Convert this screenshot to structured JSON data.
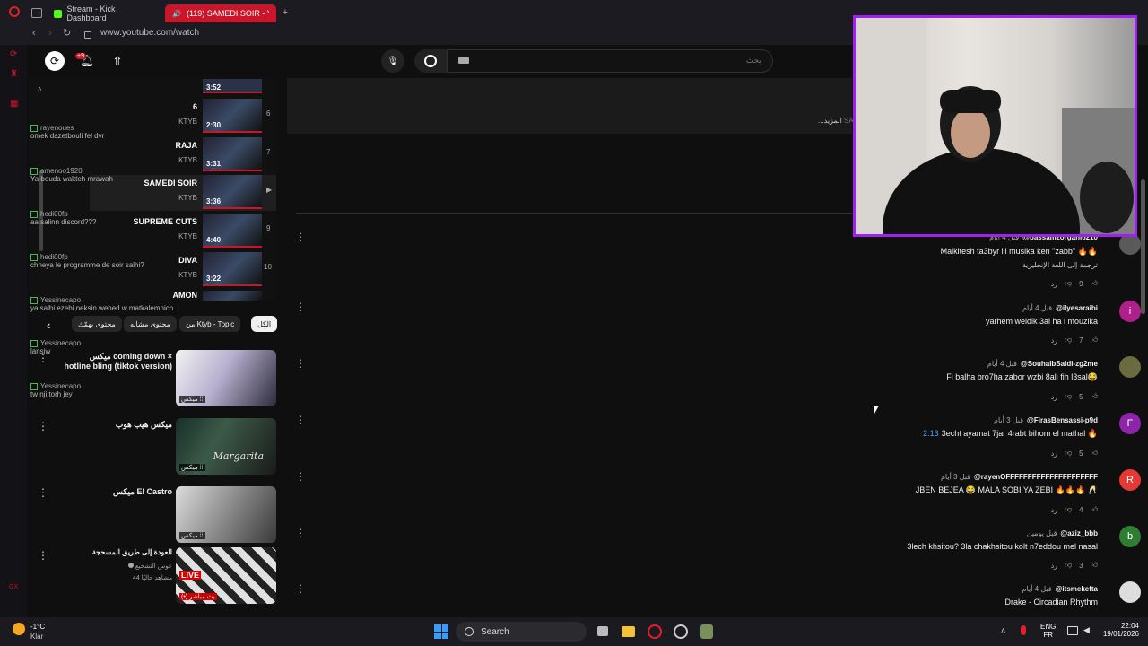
{
  "browser": {
    "tabs": [
      {
        "label": "Stream - Kick Dashboard"
      },
      {
        "label": "(119) SAMEDI SOIR - Y"
      }
    ],
    "url": "www.youtube.com/watch"
  },
  "yt_header": {
    "notification_count": "+9",
    "search_placeholder": "بحث"
  },
  "description": {
    "more_label": "...المزيد",
    "truncated_text": "SA"
  },
  "chat": [
    {
      "user": "rayenoues",
      "msg": "omek dazetbouli fel dvr"
    },
    {
      "user": "amenoo1920",
      "msg": "Ya bouda wakteh mrawah"
    },
    {
      "user": "hedi00fp",
      "msg": "aa salinn discord???"
    },
    {
      "user": "hedi00fp",
      "msg": "chneya le programme de soir salhi?"
    },
    {
      "user": "Yessinecapo",
      "msg": "ya salhi ezebi neksin wehed w matkalemnich"
    },
    {
      "user": "Yessinecapo",
      "msg": "lansiw"
    },
    {
      "user": "Yessinecapo",
      "msg": "tw nji torh jey"
    }
  ],
  "playlist": {
    "top_partial": {
      "duration": "3:52"
    },
    "items": [
      {
        "title": "6",
        "channel": "KTYB",
        "duration": "2:30",
        "index": "6"
      },
      {
        "title": "RAJA",
        "channel": "KTYB",
        "duration": "3:31",
        "index": "7"
      },
      {
        "title": "SAMEDI SOIR",
        "channel": "KTYB",
        "duration": "3:36",
        "index": "▶"
      },
      {
        "title": "SUPREME CUTS",
        "channel": "KTYB",
        "duration": "4:40",
        "index": "9"
      },
      {
        "title": "DIVA",
        "channel": "KTYB",
        "duration": "3:22",
        "index": "10"
      },
      {
        "title": "AMON",
        "channel": "",
        "duration": "",
        "index": ""
      }
    ]
  },
  "chips": [
    "الكل",
    "من Ktyb - Topic",
    "محتوى مشابه",
    "محتوى يهمّك"
  ],
  "recommendations": [
    {
      "title": "ميكس coming down × hotline bling (tiktok version)",
      "badge": "ميكس ⁞⁞"
    },
    {
      "title": "ميكس هيب هوب",
      "badge": "ميكس ⁞⁞",
      "thumb_text": "Margarita"
    },
    {
      "title": "ميكس El Castro",
      "badge": "ميكس ⁞⁞"
    },
    {
      "title": "العودة إلى طريق المسحجة",
      "channel": "عوس التشخيع",
      "viewers": "44 مشاهد حاليًا",
      "badge": "(•) بث مباشر",
      "live_label": "LIVE"
    }
  ],
  "comments": [
    {
      "author": "@bassamzorgani6210",
      "date": "قبل 4 أيام",
      "text": "Malkitesh ta3byr lil musika ken \"zabb\" 🔥🔥",
      "translate": "ترجمة إلى اللغة الإنجليزية",
      "likes": "9",
      "reply": "رد",
      "avatar_letter": "",
      "avatar_color": "#5a5a5a"
    },
    {
      "author": "@ilyesaraibi",
      "date": "قبل 4 أيام",
      "text": "yarhem weldik 3al ha l mouzika",
      "translate": "",
      "likes": "7",
      "reply": "رد",
      "avatar_letter": "i",
      "avatar_color": "#b0208a"
    },
    {
      "author": "@SouhaibSaidi-zg2me",
      "date": "قبل 4 أيام",
      "text": "Fi balha bro7ha zabor wzbi 8ali fih l3sal😂",
      "translate": "",
      "likes": "5",
      "reply": "رد",
      "avatar_letter": "",
      "avatar_color": "#6b6b40"
    },
    {
      "author": "@FirasBensassi-p9d",
      "date": "قبل 3 أيام",
      "timestamp": "2:13",
      "text": "3echt ayamat 7jar 4rabt bihom el mathal 🔥",
      "translate": "",
      "likes": "5",
      "reply": "رد",
      "avatar_letter": "F",
      "avatar_color": "#8e24aa"
    },
    {
      "author": "@rayenOFFFFFFFFFFFFFFFFFFFFF",
      "date": "قبل 3 أيام",
      "text": "JBEN BEJEA 😂 MALA SOBI YA ZEBI 🔥🔥🔥 🥂",
      "translate": "",
      "likes": "4",
      "reply": "رد",
      "avatar_letter": "R",
      "avatar_color": "#e53935"
    },
    {
      "author": "@aziz_bbb",
      "date": "قبل يومين",
      "text": "3lech khsitou? 3la chakhsitou kolt n7eddou mel nasal",
      "translate": "",
      "likes": "3",
      "reply": "رد",
      "avatar_letter": "b",
      "avatar_color": "#2e7d32"
    },
    {
      "author": "@itsmekefta",
      "date": "قبل 4 أيام",
      "text": "Drake - Circadian Rhythm",
      "translate": "",
      "likes": "",
      "reply": "",
      "avatar_letter": "",
      "avatar_color": "#ddd"
    }
  ],
  "taskbar": {
    "weather_temp": "-1°C",
    "weather_desc": "Klar",
    "search_label": "Search",
    "lang1": "ENG",
    "lang2": "FR",
    "time": "22:04",
    "date": "19/01/2026"
  },
  "colors": {
    "accent": "#c9162b",
    "webcam_border": "#a020f0",
    "kick_green": "#53fc18"
  }
}
